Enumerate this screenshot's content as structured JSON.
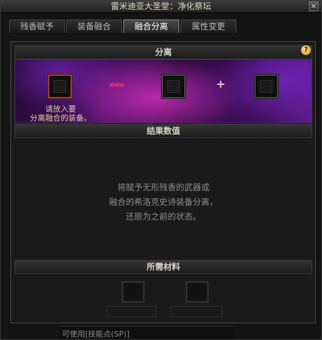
{
  "window": {
    "title": "雷米迪亚大圣堂：净化祭坛",
    "close_label": "×"
  },
  "tabs": [
    {
      "label": "残香赋予"
    },
    {
      "label": "装备融合"
    },
    {
      "label": "融合分离"
    },
    {
      "label": "属性变更"
    }
  ],
  "active_tab": "融合分离",
  "separation": {
    "title": "分离",
    "help_label": "?",
    "hint_line1": "请放入要",
    "hint_line2": "分离融合的装备。",
    "arrow_label": "»»»",
    "plus_label": "+"
  },
  "result": {
    "title": "结果数值",
    "desc_line1": "将赋予无形残香的武器或",
    "desc_line2": "融合的希洛克史诗装备分离，",
    "desc_line3": "还原为之前的状态。"
  },
  "materials": {
    "title": "所需材料"
  },
  "footer": {
    "label": "可使用[技能点(SP)]"
  }
}
